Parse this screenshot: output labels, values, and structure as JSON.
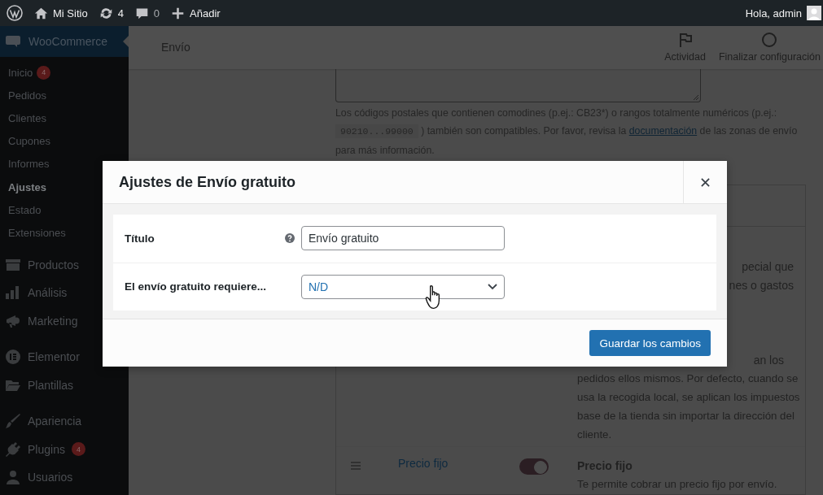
{
  "admin_bar": {
    "site": "Mi Sitio",
    "updates": "4",
    "comments": "0",
    "new": "Añadir",
    "greeting": "Hola, admin"
  },
  "sidebar": {
    "header": "WooCommerce",
    "items": [
      {
        "label": "Inicio",
        "kind": "sub",
        "selected": false,
        "badge": "4"
      },
      {
        "label": "Pedidos",
        "kind": "sub",
        "selected": false
      },
      {
        "label": "Clientes",
        "kind": "sub",
        "selected": false
      },
      {
        "label": "Cupones",
        "kind": "sub",
        "selected": false
      },
      {
        "label": "Informes",
        "kind": "sub",
        "selected": false
      },
      {
        "label": "Ajustes",
        "kind": "sub",
        "selected": true
      },
      {
        "label": "Estado",
        "kind": "sub",
        "selected": false
      },
      {
        "label": "Extensiones",
        "kind": "sub",
        "selected": false
      },
      {
        "label": "Productos",
        "kind": "main",
        "selected": false
      },
      {
        "label": "Análisis",
        "kind": "main",
        "selected": false
      },
      {
        "label": "Marketing",
        "kind": "main",
        "selected": false
      },
      {
        "label": "Elementor",
        "kind": "main",
        "selected": false
      },
      {
        "label": "Plantillas",
        "kind": "main",
        "selected": false
      },
      {
        "label": "Apariencia",
        "kind": "main",
        "selected": false
      },
      {
        "label": "Plugins",
        "kind": "main",
        "selected": false,
        "badge": "4"
      },
      {
        "label": "Usuarios",
        "kind": "main",
        "selected": false
      }
    ]
  },
  "header": {
    "title": "Envío",
    "actions": [
      {
        "label": "Actividad"
      },
      {
        "label": "Finalizar configuración"
      }
    ]
  },
  "help_text": {
    "before": "Los códigos postales que contienen comodines (p.ej.: CB23*) o rangos totalmente numéricos (p.ej.: ",
    "code": "90210...99000",
    "middle": " ) también son compatibles. Por favor, revisa la ",
    "link": "documentación",
    "after": " de las zonas de envío para más información."
  },
  "methods": [
    {
      "description_fragments": [
        "pecial que",
        "nes o gastos"
      ]
    },
    {
      "description_fragments": [
        "an los"
      ],
      "description": "pedidos ellos mismos. Por defecto, cuando se usa la recogida local, se aplican los impuestos base de la tienda sin importar la dirección del cliente."
    },
    {
      "name": "Precio fijo",
      "enabled": true,
      "title": "Precio fijo",
      "description": "Te permite cobrar un precio fijo por envío."
    }
  ],
  "modal": {
    "title": "Ajustes de Envío gratuito",
    "fields": [
      {
        "label": "Título",
        "kind": "text",
        "help": true,
        "value": "Envío gratuito"
      },
      {
        "label": "El envío gratuito requiere...",
        "kind": "select",
        "help": false,
        "value": "N/D"
      }
    ],
    "button": "Guardar los cambios"
  }
}
